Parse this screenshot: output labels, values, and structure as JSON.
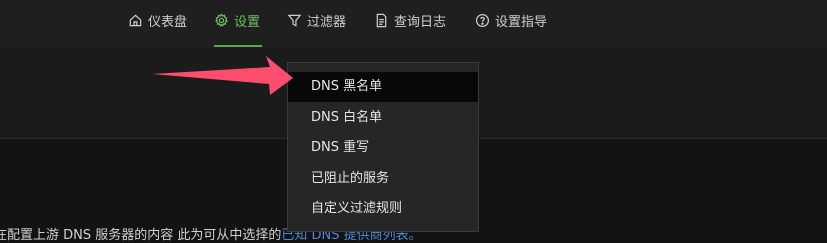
{
  "nav": {
    "items": [
      {
        "label": "仪表盘",
        "icon": "home-icon"
      },
      {
        "label": "设置",
        "icon": "gear-icon",
        "active": true
      },
      {
        "label": "过滤器",
        "icon": "filter-icon"
      },
      {
        "label": "查询日志",
        "icon": "document-icon"
      },
      {
        "label": "设置指导",
        "icon": "help-circle-icon"
      }
    ]
  },
  "dropdown": {
    "items": [
      {
        "label": "DNS 黑名单",
        "highlighted": true
      },
      {
        "label": "DNS 白名单"
      },
      {
        "label": "DNS 重写"
      },
      {
        "label": "已阻止的服务"
      },
      {
        "label": "自定义过滤规则"
      }
    ]
  },
  "body": {
    "text_before": "在配置上游 DNS 服务器的内容 此为可从中选择的",
    "link_text": "已知 DNS 提供商列表。"
  },
  "colors": {
    "accent": "#6fbf5f",
    "arrow": "#ff4d6d",
    "link": "#4b8bd6"
  }
}
